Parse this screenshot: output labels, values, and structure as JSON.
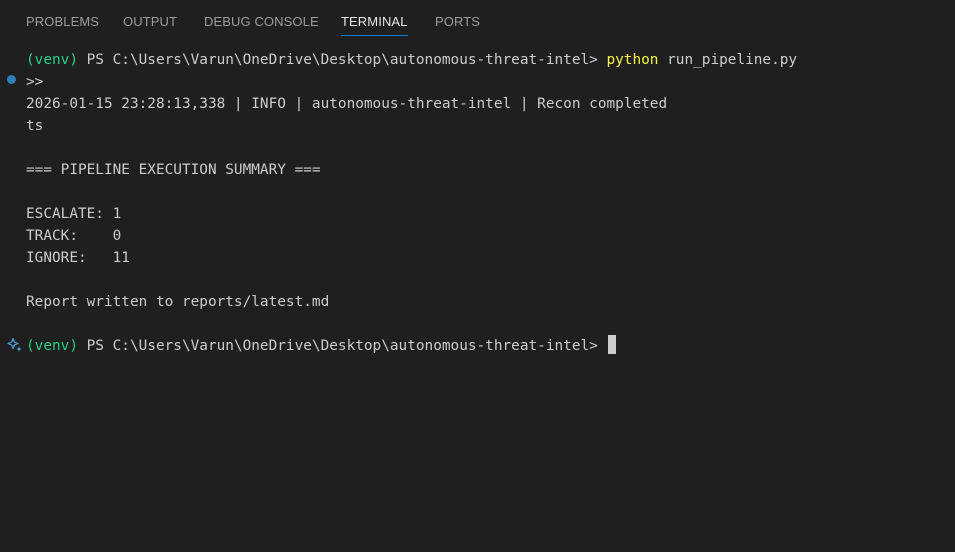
{
  "tabs": [
    {
      "label": "PROBLEMS",
      "active": false
    },
    {
      "label": "OUTPUT",
      "active": false
    },
    {
      "label": "DEBUG CONSOLE",
      "active": false
    },
    {
      "label": "TERMINAL",
      "active": true
    },
    {
      "label": "PORTS",
      "active": false
    }
  ],
  "terminal": {
    "prompt1": {
      "venv": "(venv)",
      "ps": " PS C:\\Users\\Varun\\OneDrive\\Desktop\\autonomous-threat-intel> ",
      "command": "python",
      "args": " run_pipeline.py"
    },
    "continuation": ">>",
    "log_line": "2026-01-15 23:28:13,338 | INFO | autonomous-threat-intel | Recon completed",
    "log_wrap": "ts",
    "summary_header": "=== PIPELINE EXECUTION SUMMARY ===",
    "escalate": "ESCALATE: 1",
    "track": "TRACK:    0",
    "ignore": "IGNORE:   11",
    "report": "Report written to reports/latest.md",
    "prompt2": {
      "venv": "(venv)",
      "ps": " PS C:\\Users\\Varun\\OneDrive\\Desktop\\autonomous-threat-intel>"
    },
    "gutter_icons": [
      "command-decoration-dot-icon",
      "sparkle-icon"
    ]
  },
  "colors": {
    "background": "#1f1f1f",
    "text": "#cccccc",
    "venv": "#23d18b",
    "command": "#f5f543",
    "tab_active_underline": "#0078d4",
    "decoration_dot": "#2f7fb5"
  }
}
